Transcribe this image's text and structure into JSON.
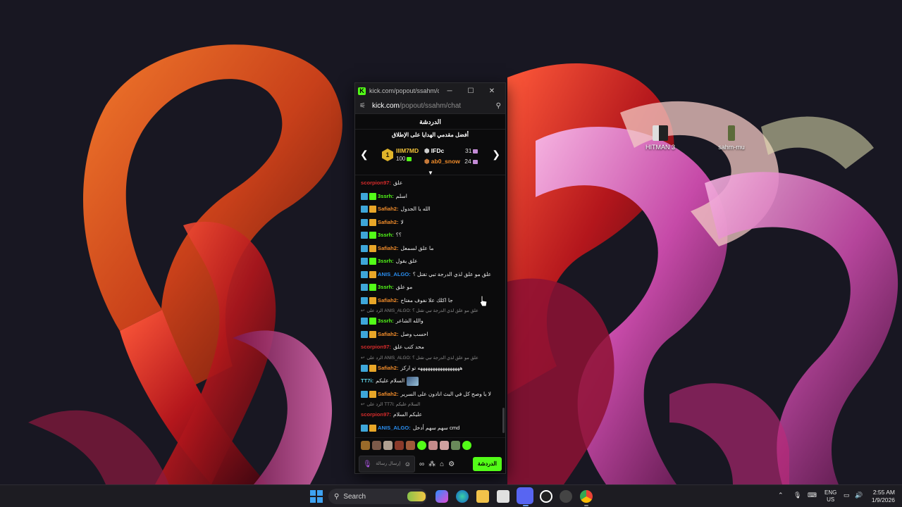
{
  "desktop": {
    "icons": [
      {
        "label": "HITMAN 3"
      },
      {
        "label": "sahm-mu"
      }
    ]
  },
  "window": {
    "title": "kick.com/popout/ssahm/ch...",
    "address": {
      "host": "kick.com",
      "path": "/popout/ssahm/chat"
    },
    "chat_header": "الدردشة",
    "leaderboard": {
      "title": "أفضل مقدمي الهدايا على الإطلاق",
      "first": {
        "rank": "1",
        "name": "IIIM7MD",
        "amount": "100"
      },
      "second": {
        "name": "IFDc",
        "amount": "31"
      },
      "third": {
        "name": "ab0_snow",
        "amount": "24"
      }
    },
    "messages": [
      {
        "user": "scorpion97:",
        "text": "علق",
        "color": "red",
        "badges": []
      },
      {
        "user": "3ssrh:",
        "text": "اسلم",
        "color": "green",
        "badges": [
          "mod",
          "sub"
        ]
      },
      {
        "user": "Safiah2:",
        "text": "الله يا الجدول",
        "color": "orange",
        "badges": [
          "mod",
          "crown"
        ]
      },
      {
        "user": "Safiah2:",
        "text": "لا",
        "color": "orange",
        "badges": [
          "mod",
          "crown"
        ]
      },
      {
        "user": "3ssrh:",
        "text": "؟؟",
        "color": "green",
        "badges": [
          "mod",
          "sub"
        ]
      },
      {
        "user": "Safiah2:",
        "text": "ما علق لسمعل",
        "color": "orange",
        "badges": [
          "mod",
          "crown"
        ]
      },
      {
        "user": "3ssrh:",
        "text": "علق يقول",
        "color": "green",
        "badges": [
          "mod",
          "sub"
        ]
      },
      {
        "user": "ANIS_ALGO:",
        "text": "علق مو علق لذي الدرجة تبي تقتل ؟",
        "color": "blue",
        "badges": [
          "mod",
          "crown"
        ]
      },
      {
        "user": "3ssrh:",
        "text": "مو علق",
        "color": "green",
        "badges": [
          "mod",
          "sub"
        ]
      },
      {
        "user": "Safiah2:",
        "text": "جا اكلك علا نفوف مفتاح",
        "color": "orange",
        "badges": [
          "mod",
          "crown"
        ]
      },
      {
        "reply": "الرد على ANIS_ALGO: علق مو علق لذي الدرجة تبي تقتل ؟"
      },
      {
        "user": "3ssrh:",
        "text": "والله الشاعر",
        "color": "green",
        "badges": [
          "mod",
          "sub"
        ]
      },
      {
        "user": "Safiah2:",
        "text": "احسب وصل",
        "color": "orange",
        "badges": [
          "mod",
          "crown"
        ]
      },
      {
        "user": "scorpion97:",
        "text": "محد كتب علق",
        "color": "red",
        "badges": []
      },
      {
        "reply": "الرد على ANIS_ALGO: علق مو علق لذي الدرجة تبي تقتل ؟"
      },
      {
        "user": "Safiah2:",
        "text": "هههههههههههههههههه تو اركز",
        "color": "orange",
        "badges": [
          "mod",
          "crown"
        ]
      },
      {
        "user": "TT7i:",
        "text": "السلام عليكم",
        "color": "cyan",
        "badges": [],
        "thumb": true
      },
      {
        "user": "Safiah2:",
        "text": "لا يا وصح كل في البث انادون على السرير",
        "color": "orange",
        "badges": [
          "mod",
          "crown"
        ]
      },
      {
        "reply": "الرد على TT7i: السلام عليكم"
      },
      {
        "user": "scorpion97:",
        "text": "عليكم السلام",
        "color": "red",
        "badges": []
      },
      {
        "user": "ANIS_ALGO:",
        "text": "سهم سهم أدخل cmd",
        "color": "blue",
        "badges": [
          "mod",
          "crown"
        ]
      }
    ],
    "composer": {
      "placeholder": "إرسال رسالة",
      "chat_button": "الدردشة"
    }
  },
  "taskbar": {
    "search_label": "Search",
    "lang_top": "ENG",
    "lang_bottom": "US",
    "time": "2:55 AM",
    "date": "1/9/2026"
  },
  "colors": {
    "kick_green": "#53fc18",
    "name_red": "#d52b2b",
    "name_green": "#53fc18",
    "name_orange": "#ef8b2a",
    "name_blue": "#2a8ef0",
    "name_cyan": "#5fd3e8"
  }
}
